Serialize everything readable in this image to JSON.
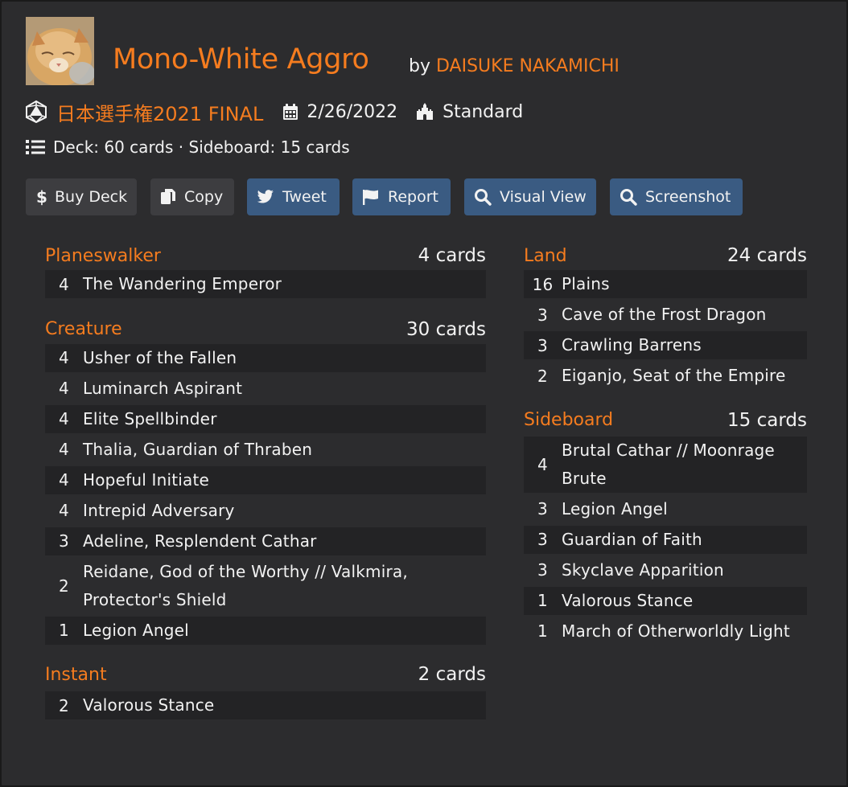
{
  "deck": {
    "title": "Mono-White Aggro",
    "by_label": "by",
    "author": "DAISUKE NAKAMICHI",
    "event": "日本選手権2021 FINAL",
    "date": "2/26/2022",
    "format": "Standard",
    "counts": "Deck: 60 cards · Sideboard: 15 cards"
  },
  "icons": {
    "event": "d20-dice-icon",
    "date": "calendar-icon",
    "format": "castle-icon",
    "counts": "list-icon"
  },
  "colors": {
    "accent": "#f57c1f",
    "button_gray": "#3d3d40",
    "button_blue": "#3a5b82",
    "panel": "#2c2c2e"
  },
  "buttons": [
    {
      "label": "Buy Deck",
      "icon": "dollar-icon"
    },
    {
      "label": "Copy",
      "icon": "copy-icon"
    },
    {
      "label": "Tweet",
      "icon": "twitter-icon"
    },
    {
      "label": "Report",
      "icon": "flag-icon"
    },
    {
      "label": "Visual View",
      "icon": "search-icon"
    },
    {
      "label": "Screenshot",
      "icon": "search-icon"
    }
  ],
  "left_sections": [
    {
      "name": "Planeswalker",
      "count": "4 cards",
      "cards": [
        {
          "qty": "4",
          "name": "The Wandering Emperor"
        }
      ]
    },
    {
      "name": "Creature",
      "count": "30 cards",
      "cards": [
        {
          "qty": "4",
          "name": "Usher of the Fallen"
        },
        {
          "qty": "4",
          "name": "Luminarch Aspirant"
        },
        {
          "qty": "4",
          "name": "Elite Spellbinder"
        },
        {
          "qty": "4",
          "name": "Thalia, Guardian of Thraben"
        },
        {
          "qty": "4",
          "name": "Hopeful Initiate"
        },
        {
          "qty": "4",
          "name": "Intrepid Adversary"
        },
        {
          "qty": "3",
          "name": "Adeline, Resplendent Cathar"
        },
        {
          "qty": "2",
          "name": "Reidane, God of the Worthy // Valkmira, Protector's Shield"
        },
        {
          "qty": "1",
          "name": "Legion Angel"
        }
      ]
    },
    {
      "name": "Instant",
      "count": "2 cards",
      "cards": [
        {
          "qty": "2",
          "name": "Valorous Stance"
        }
      ]
    }
  ],
  "right_sections": [
    {
      "name": "Land",
      "count": "24 cards",
      "cards": [
        {
          "qty": "16",
          "name": "Plains"
        },
        {
          "qty": "3",
          "name": "Cave of the Frost Dragon"
        },
        {
          "qty": "3",
          "name": "Crawling Barrens"
        },
        {
          "qty": "2",
          "name": "Eiganjo, Seat of the Empire"
        }
      ]
    },
    {
      "name": "Sideboard",
      "count": "15 cards",
      "cards": [
        {
          "qty": "4",
          "name": "Brutal Cathar // Moonrage Brute"
        },
        {
          "qty": "3",
          "name": "Legion Angel"
        },
        {
          "qty": "3",
          "name": "Guardian of Faith"
        },
        {
          "qty": "3",
          "name": "Skyclave Apparition"
        },
        {
          "qty": "1",
          "name": "Valorous Stance"
        },
        {
          "qty": "1",
          "name": "March of Otherworldly Light"
        }
      ]
    }
  ]
}
